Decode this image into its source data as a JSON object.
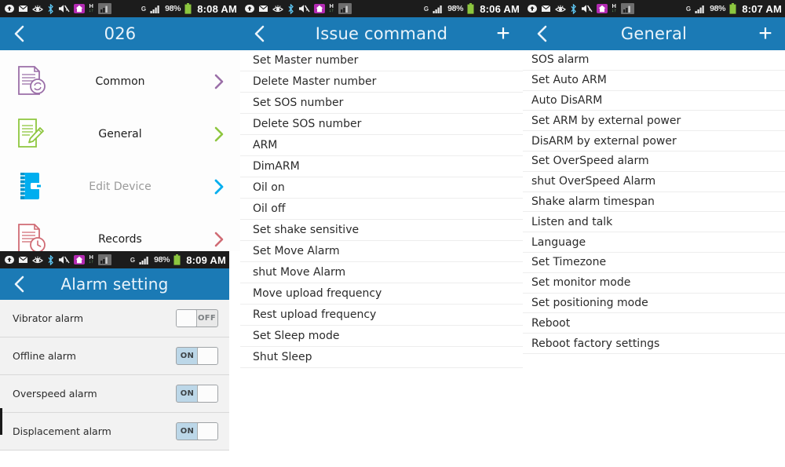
{
  "statusbar": {
    "icons": [
      "download-icon",
      "envelope-icon",
      "eye-icon",
      "bluetooth-icon",
      "mute-icon",
      "home-icon",
      "hsdpa-icon",
      "screen-icon",
      "gsm-g-icon",
      "signal-icon"
    ],
    "battery_percent": "98%",
    "hsdpa_label": "H",
    "network_label": "G",
    "times": {
      "device": "8:08 AM",
      "command": "8:06 AM",
      "general": "8:07 AM",
      "alarm": "8:09 AM"
    }
  },
  "colors": {
    "header_blue": "#1b7ab5",
    "statusbar_black": "#1c1c1c",
    "accent_purple": "#9b6fa8",
    "accent_green": "#8ec63f",
    "accent_blue": "#00aeef",
    "accent_red": "#d06b74",
    "toggle_on_blue": "#bcd7e8",
    "battery_green": "#8cc63f",
    "home_magenta": "#b32bb3"
  },
  "panels": {
    "device": {
      "header": {
        "title": "026",
        "back_icon": "back-chevron-icon"
      },
      "items": [
        {
          "label": "Common",
          "icon": "document-refresh-icon",
          "color": "#9b6fa8",
          "dimmed": false
        },
        {
          "label": "General",
          "icon": "document-pencil-icon",
          "color": "#8ec63f",
          "dimmed": false
        },
        {
          "label": "Edit Device",
          "icon": "notebook-icon",
          "color": "#00aeef",
          "dimmed": true
        },
        {
          "label": "Records",
          "icon": "document-clock-icon",
          "color": "#d06b74",
          "dimmed": false
        }
      ]
    },
    "command": {
      "header": {
        "title": "Issue command",
        "back_icon": "back-chevron-icon",
        "add_label": "+"
      },
      "items": [
        "Set Master number",
        "Delete Master number",
        "Set SOS number",
        "Delete SOS number",
        "ARM",
        "DimARM",
        "Oil on",
        "Oil off",
        "Set shake sensitive",
        "Set Move Alarm",
        "shut Move Alarm",
        "Move upload frequency",
        "Rest upload frequency",
        "Set Sleep mode",
        "Shut Sleep"
      ]
    },
    "general": {
      "header": {
        "title": "General",
        "back_icon": "back-chevron-icon",
        "add_label": "+"
      },
      "items": [
        "SOS alarm",
        "Set Auto ARM",
        "Auto DisARM",
        "Set ARM by external power",
        "DisARM by external power",
        "Set OverSpeed alarm",
        "shut OverSpeed Alarm",
        "Shake alarm timespan",
        "Listen and talk",
        "Language",
        "Set Timezone",
        "Set monitor mode",
        "Set positioning mode",
        "Reboot",
        "Reboot factory settings"
      ]
    },
    "alarm": {
      "header": {
        "title": "Alarm setting",
        "back_icon": "back-chevron-icon"
      },
      "rows": [
        {
          "label": "Vibrator alarm",
          "state": "OFF"
        },
        {
          "label": "Offline alarm",
          "state": "ON"
        },
        {
          "label": "Overspeed alarm",
          "state": "ON"
        },
        {
          "label": "Displacement alarm",
          "state": "ON"
        }
      ]
    }
  }
}
